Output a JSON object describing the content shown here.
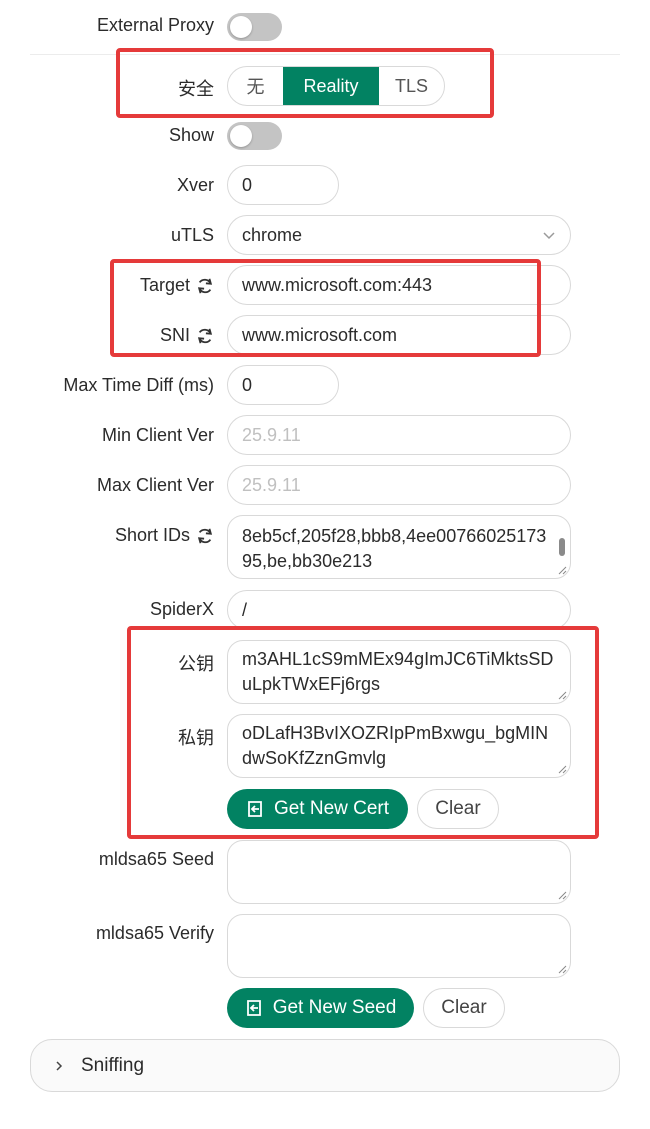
{
  "external_proxy": {
    "label": "External Proxy",
    "enabled": false
  },
  "security": {
    "label": "安全",
    "options": [
      "无",
      "Reality",
      "TLS"
    ],
    "selected": "Reality"
  },
  "show": {
    "label": "Show",
    "enabled": false
  },
  "xver": {
    "label": "Xver",
    "value": "0"
  },
  "utls": {
    "label": "uTLS",
    "value": "chrome"
  },
  "target": {
    "label": "Target",
    "value": "www.microsoft.com:443"
  },
  "sni": {
    "label": "SNI",
    "value": "www.microsoft.com"
  },
  "max_time_diff": {
    "label": "Max Time Diff (ms)",
    "value": "0"
  },
  "min_client_ver": {
    "label": "Min Client Ver",
    "placeholder": "25.9.11"
  },
  "max_client_ver": {
    "label": "Max Client Ver",
    "placeholder": "25.9.11"
  },
  "short_ids": {
    "label": "Short IDs",
    "value": "8eb5cf,205f28,bbb8,4ee0076602517395,be,bb30e213"
  },
  "spiderx": {
    "label": "SpiderX",
    "value": "/"
  },
  "public_key": {
    "label": "公钥",
    "value": "m3AHL1cS9mMEx94gImJC6TiMktsSDuLpkTWxEFj6rgs"
  },
  "private_key": {
    "label": "私钥",
    "value": "oDLafH3BvIXOZRIpPmBxwgu_bgMINdwSoKfZznGmvlg"
  },
  "cert_buttons": {
    "get_new_cert": "Get New Cert",
    "clear": "Clear"
  },
  "mldsa65_seed": {
    "label": "mldsa65 Seed",
    "value": ""
  },
  "mldsa65_verify": {
    "label": "mldsa65 Verify",
    "value": ""
  },
  "seed_buttons": {
    "get_new_seed": "Get New Seed",
    "clear": "Clear"
  },
  "sniffing": {
    "label": "Sniffing"
  },
  "colors": {
    "accent": "#028262",
    "highlight": "#e53a3a"
  }
}
